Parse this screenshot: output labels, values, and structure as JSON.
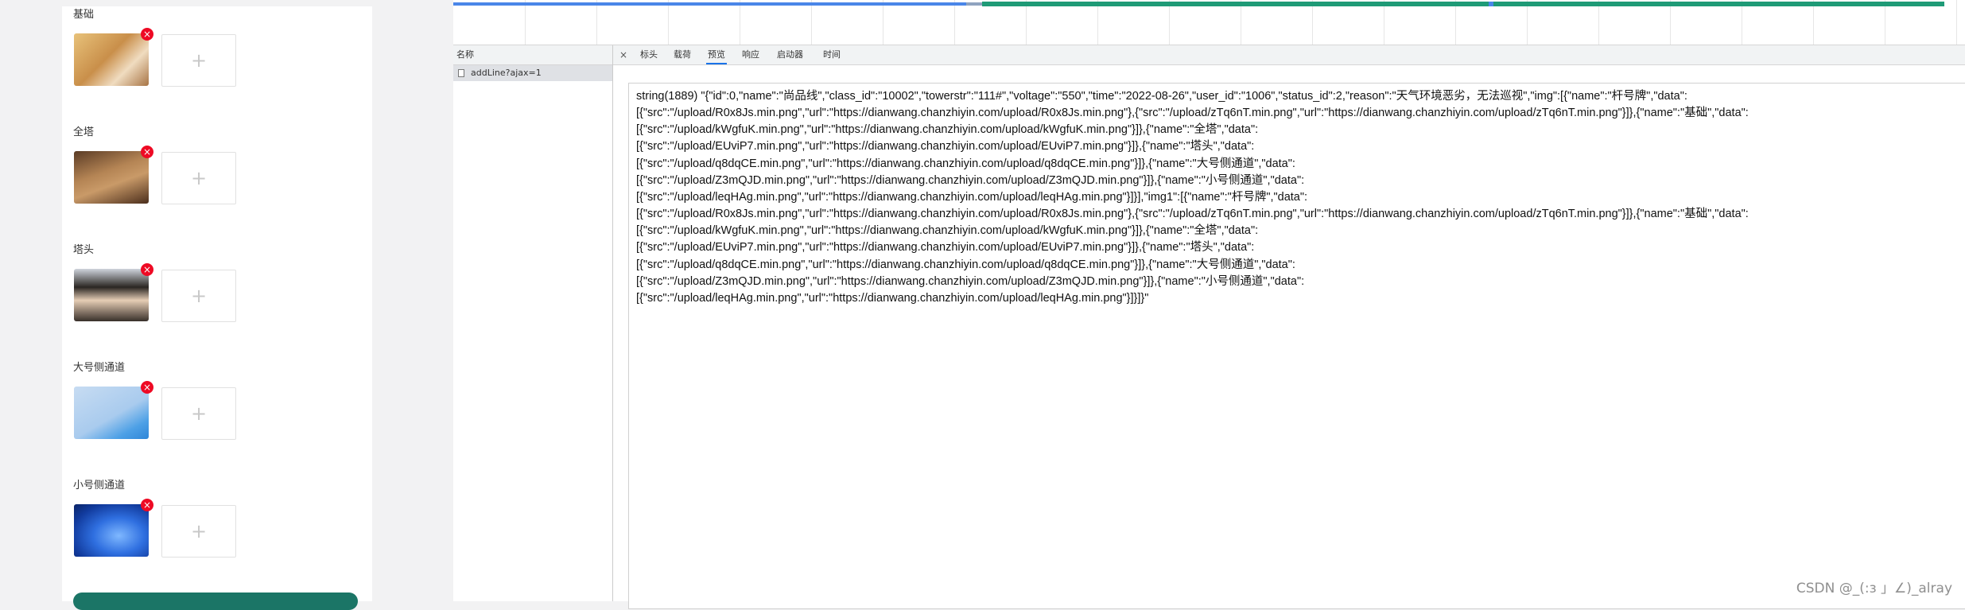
{
  "form": {
    "sections": [
      {
        "label": "基础",
        "delete_icon": "×",
        "add_icon": "+"
      },
      {
        "label": "全塔",
        "delete_icon": "×",
        "add_icon": "+"
      },
      {
        "label": "塔头",
        "delete_icon": "×",
        "add_icon": "+"
      },
      {
        "label": "大号侧通道",
        "delete_icon": "×",
        "add_icon": "+"
      },
      {
        "label": "小号侧通道",
        "delete_icon": "×",
        "add_icon": "+"
      }
    ],
    "submit_color": "#1b7566"
  },
  "network": {
    "name_header": "名称",
    "requests": [
      {
        "name": "addLine?ajax=1"
      }
    ],
    "tabs": [
      {
        "label": "标头"
      },
      {
        "label": "载荷"
      },
      {
        "label": "预览"
      },
      {
        "label": "响应"
      },
      {
        "label": "启动器"
      },
      {
        "label": "时间"
      }
    ],
    "active_tab": "预览",
    "close_icon": "×",
    "preview_lines": [
      "string(1889) \"{\"id\":0,\"name\":\"尚品线\",\"class_id\":\"10002\",\"towerstr\":\"111#\",\"voltage\":\"550\",\"time\":\"2022-08-26\",\"user_id\":\"1006\",\"status_id\":2,\"reason\":\"天气环境恶劣，无法巡视\",\"img\":[{\"name\":\"杆号牌\",\"data\":",
      "[{\"src\":\"/upload/R0x8Js.min.png\",\"url\":\"https://dianwang.chanzhiyin.com/upload/R0x8Js.min.png\"},{\"src\":\"/upload/zTq6nT.min.png\",\"url\":\"https://dianwang.chanzhiyin.com/upload/zTq6nT.min.png\"}]},{\"name\":\"基础\",\"data\":",
      "[{\"src\":\"/upload/kWgfuK.min.png\",\"url\":\"https://dianwang.chanzhiyin.com/upload/kWgfuK.min.png\"}]},{\"name\":\"全塔\",\"data\":",
      "[{\"src\":\"/upload/EUviP7.min.png\",\"url\":\"https://dianwang.chanzhiyin.com/upload/EUviP7.min.png\"}]},{\"name\":\"塔头\",\"data\":",
      "[{\"src\":\"/upload/q8dqCE.min.png\",\"url\":\"https://dianwang.chanzhiyin.com/upload/q8dqCE.min.png\"}]},{\"name\":\"大号侧通道\",\"data\":",
      "[{\"src\":\"/upload/Z3mQJD.min.png\",\"url\":\"https://dianwang.chanzhiyin.com/upload/Z3mQJD.min.png\"}]},{\"name\":\"小号侧通道\",\"data\":",
      "[{\"src\":\"/upload/leqHAg.min.png\",\"url\":\"https://dianwang.chanzhiyin.com/upload/leqHAg.min.png\"}]}],\"img1\":[{\"name\":\"杆号牌\",\"data\":",
      "[{\"src\":\"/upload/R0x8Js.min.png\",\"url\":\"https://dianwang.chanzhiyin.com/upload/R0x8Js.min.png\"},{\"src\":\"/upload/zTq6nT.min.png\",\"url\":\"https://dianwang.chanzhiyin.com/upload/zTq6nT.min.png\"}]},{\"name\":\"基础\",\"data\":",
      "[{\"src\":\"/upload/kWgfuK.min.png\",\"url\":\"https://dianwang.chanzhiyin.com/upload/kWgfuK.min.png\"}]},{\"name\":\"全塔\",\"data\":",
      "[{\"src\":\"/upload/EUviP7.min.png\",\"url\":\"https://dianwang.chanzhiyin.com/upload/EUviP7.min.png\"}]},{\"name\":\"塔头\",\"data\":",
      "[{\"src\":\"/upload/q8dqCE.min.png\",\"url\":\"https://dianwang.chanzhiyin.com/upload/q8dqCE.min.png\"}]},{\"name\":\"大号侧通道\",\"data\":",
      "[{\"src\":\"/upload/Z3mQJD.min.png\",\"url\":\"https://dianwang.chanzhiyin.com/upload/Z3mQJD.min.png\"}]},{\"name\":\"小号侧通道\",\"data\":",
      "[{\"src\":\"/upload/leqHAg.min.png\",\"url\":\"https://dianwang.chanzhiyin.com/upload/leqHAg.min.png\"}]}]}\""
    ]
  },
  "watermark": "CSDN @_(:з 」∠)_alray"
}
